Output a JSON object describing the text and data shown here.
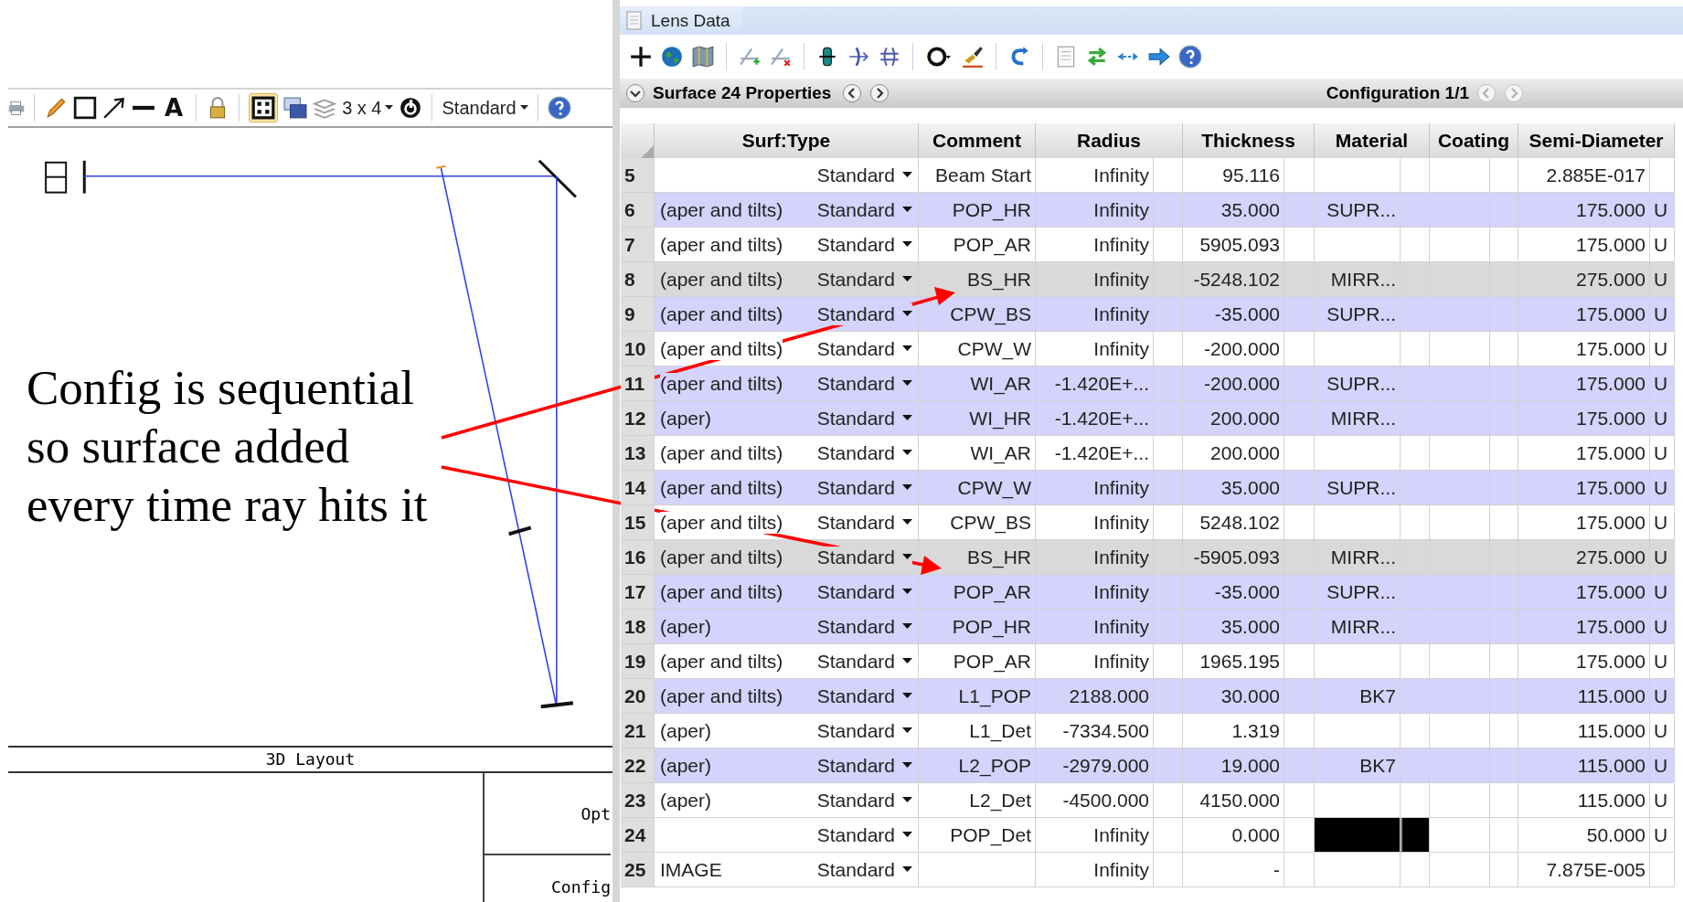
{
  "layout_window": {
    "toolbar": {
      "text_tool": "A",
      "grid_selected": true,
      "layout": "3 x 4",
      "view": "Standard"
    },
    "footer_title": "3D Layout",
    "info_cells": [
      "Opt",
      "Config"
    ]
  },
  "annotation": {
    "text": "Config is sequential\nso surface added\nevery time ray hits it"
  },
  "lens_data": {
    "title": "Lens Data",
    "properties": {
      "title": "Surface 24 Properties",
      "configuration": "Configuration 1/1"
    },
    "columns": [
      "Surf:Type",
      "Comment",
      "Radius",
      "Thickness",
      "Material",
      "Coating",
      "Semi-Diameter"
    ],
    "rows": [
      {
        "number": "5",
        "type": "Standard",
        "comment": "Beam Start",
        "radius": "Infinity",
        "thickness": "95.116",
        "semi_diameter": "2.885E-017",
        "kind": "plain",
        "selected": false
      },
      {
        "number": "6",
        "note": "(aper and tilts)",
        "type": "Standard",
        "comment": "POP_HR",
        "radius": "Infinity",
        "thickness": "35.000",
        "material": "SUPR...",
        "semi_diameter": "175.000",
        "unit": "U",
        "kind": "tinted",
        "selected": false
      },
      {
        "number": "7",
        "note": "(aper and tilts)",
        "type": "Standard",
        "comment": "POP_AR",
        "radius": "Infinity",
        "thickness": "5905.093",
        "semi_diameter": "175.000",
        "unit": "U",
        "kind": "plain",
        "selected": false
      },
      {
        "number": "8",
        "note": "(aper and tilts)",
        "type": "Standard",
        "comment": "BS_HR",
        "radius": "Infinity",
        "thickness": "-5248.102",
        "material": "MIRR...",
        "semi_diameter": "275.000",
        "unit": "U",
        "kind": "gray",
        "selected": false
      },
      {
        "number": "9",
        "note": "(aper and tilts)",
        "type": "Standard",
        "comment": "CPW_BS",
        "radius": "Infinity",
        "thickness": "-35.000",
        "material": "SUPR...",
        "semi_diameter": "175.000",
        "unit": "U",
        "kind": "tinted",
        "selected": false
      },
      {
        "number": "10",
        "note": "(aper and tilts)",
        "type": "Standard",
        "comment": "CPW_W",
        "radius": "Infinity",
        "thickness": "-200.000",
        "semi_diameter": "175.000",
        "unit": "U",
        "kind": "plain",
        "selected": false
      },
      {
        "number": "11",
        "note": "(aper and tilts)",
        "type": "Standard",
        "comment": "WI_AR",
        "radius": "-1.420E+...",
        "thickness": "-200.000",
        "material": "SUPR...",
        "semi_diameter": "175.000",
        "unit": "U",
        "kind": "tinted",
        "selected": false
      },
      {
        "number": "12",
        "note": "(aper)",
        "type": "Standard",
        "comment": "WI_HR",
        "radius": "-1.420E+...",
        "thickness": "200.000",
        "material": "MIRR...",
        "semi_diameter": "175.000",
        "unit": "U",
        "kind": "tinted",
        "selected": false
      },
      {
        "number": "13",
        "note": "(aper and tilts)",
        "type": "Standard",
        "comment": "WI_AR",
        "radius": "-1.420E+...",
        "thickness": "200.000",
        "semi_diameter": "175.000",
        "unit": "U",
        "kind": "plain",
        "selected": false
      },
      {
        "number": "14",
        "note": "(aper and tilts)",
        "type": "Standard",
        "comment": "CPW_W",
        "radius": "Infinity",
        "thickness": "35.000",
        "material": "SUPR...",
        "semi_diameter": "175.000",
        "unit": "U",
        "kind": "tinted",
        "selected": false
      },
      {
        "number": "15",
        "note": "(aper and tilts)",
        "type": "Standard",
        "comment": "CPW_BS",
        "radius": "Infinity",
        "thickness": "5248.102",
        "semi_diameter": "175.000",
        "unit": "U",
        "kind": "plain",
        "selected": false
      },
      {
        "number": "16",
        "note": "(aper and tilts)",
        "type": "Standard",
        "comment": "BS_HR",
        "radius": "Infinity",
        "thickness": "-5905.093",
        "material": "MIRR...",
        "semi_diameter": "275.000",
        "unit": "U",
        "kind": "gray",
        "selected": false
      },
      {
        "number": "17",
        "note": "(aper and tilts)",
        "type": "Standard",
        "comment": "POP_AR",
        "radius": "Infinity",
        "thickness": "-35.000",
        "material": "SUPR...",
        "semi_diameter": "175.000",
        "unit": "U",
        "kind": "tinted",
        "selected": false
      },
      {
        "number": "18",
        "note": "(aper)",
        "type": "Standard",
        "comment": "POP_HR",
        "radius": "Infinity",
        "thickness": "35.000",
        "material": "MIRR...",
        "semi_diameter": "175.000",
        "unit": "U",
        "kind": "tinted",
        "selected": false
      },
      {
        "number": "19",
        "note": "(aper and tilts)",
        "type": "Standard",
        "comment": "POP_AR",
        "radius": "Infinity",
        "thickness": "1965.195",
        "semi_diameter": "175.000",
        "unit": "U",
        "kind": "plain",
        "selected": false
      },
      {
        "number": "20",
        "note": "(aper and tilts)",
        "type": "Standard",
        "comment": "L1_POP",
        "radius": "2188.000",
        "thickness": "30.000",
        "material": "BK7",
        "semi_diameter": "115.000",
        "unit": "U",
        "kind": "tinted",
        "selected": false
      },
      {
        "number": "21",
        "note": "(aper)",
        "type": "Standard",
        "comment": "L1_Det",
        "radius": "-7334.500",
        "thickness": "1.319",
        "semi_diameter": "115.000",
        "unit": "U",
        "kind": "plain",
        "selected": false
      },
      {
        "number": "22",
        "note": "(aper)",
        "type": "Standard",
        "comment": "L2_POP",
        "radius": "-2979.000",
        "thickness": "19.000",
        "material": "BK7",
        "semi_diameter": "115.000",
        "unit": "U",
        "kind": "tinted",
        "selected": false
      },
      {
        "number": "23",
        "note": "(aper)",
        "type": "Standard",
        "comment": "L2_Det",
        "radius": "-4500.000",
        "thickness": "4150.000",
        "semi_diameter": "115.000",
        "unit": "U",
        "kind": "plain",
        "selected": false
      },
      {
        "number": "24",
        "type": "Standard",
        "comment": "POP_Det",
        "radius": "Infinity",
        "thickness": "0.000",
        "semi_diameter": "50.000",
        "unit": "U",
        "kind": "plain",
        "selected": true
      },
      {
        "number": "25",
        "note": "IMAGE",
        "type": "Standard",
        "radius": "Infinity",
        "thickness": "-",
        "semi_diameter": "7.875E-005",
        "kind": "plain",
        "selected": false
      }
    ]
  }
}
